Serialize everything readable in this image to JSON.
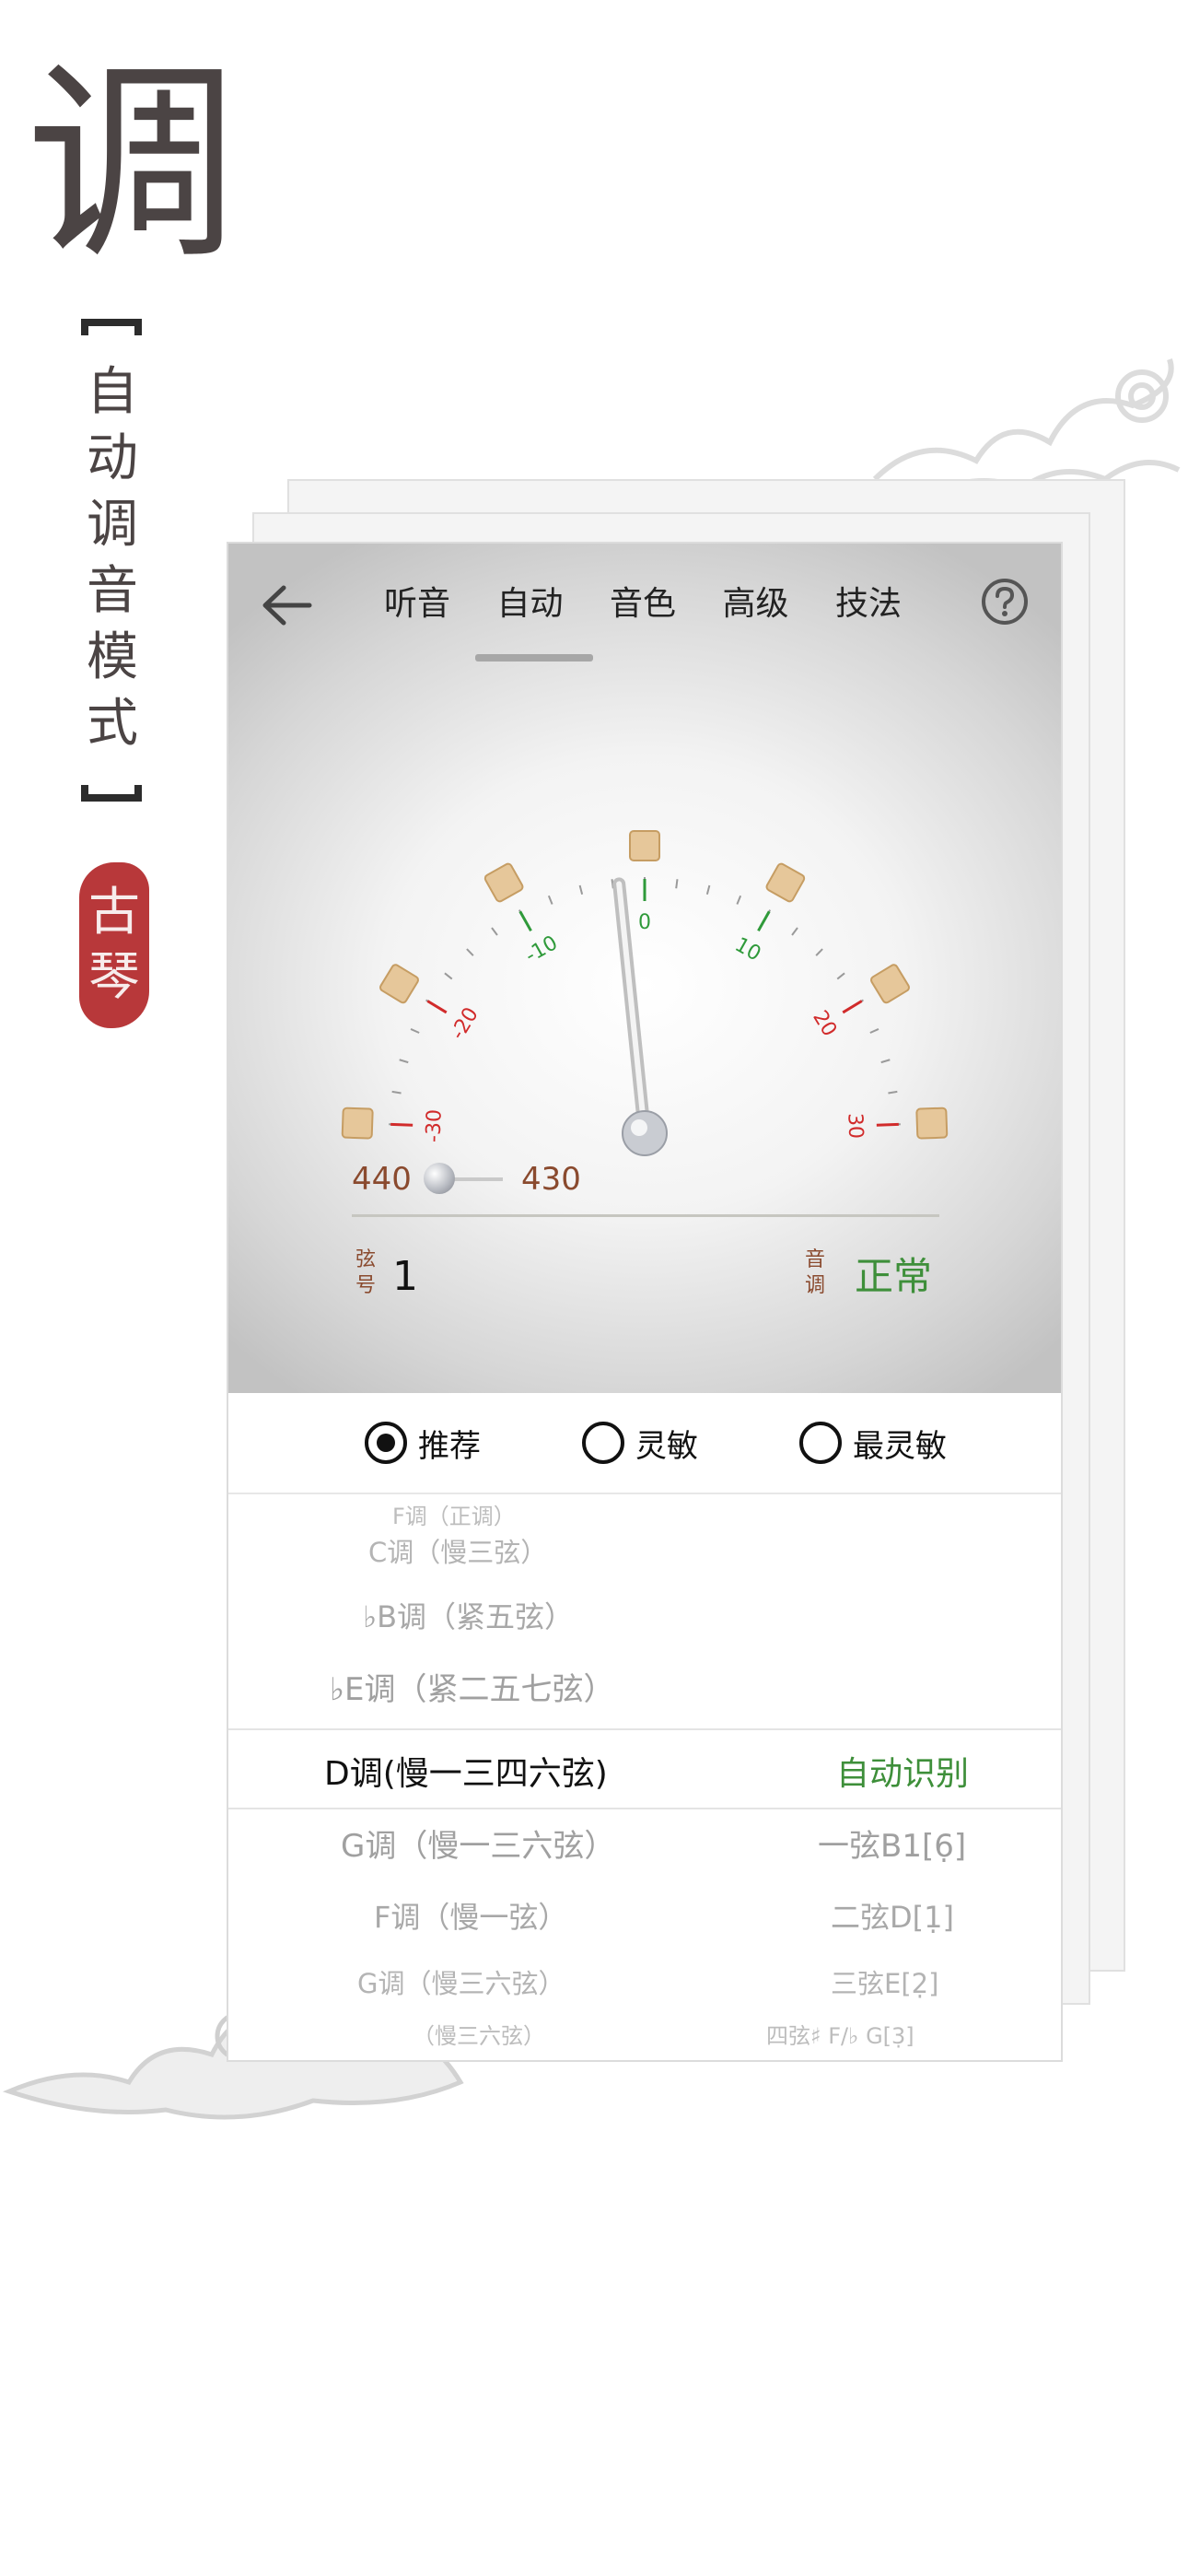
{
  "left_panel": {
    "big_char": "调",
    "mode_title": "自动调音模式",
    "seal_text": "古琴"
  },
  "header": {
    "tabs": [
      {
        "label": "听音"
      },
      {
        "label": "自动"
      },
      {
        "label": "音色"
      },
      {
        "label": "高级"
      },
      {
        "label": "技法"
      }
    ],
    "active_tab": 1
  },
  "gauge": {
    "ticks": [
      {
        "label": "-30",
        "color": "#d12b2b"
      },
      {
        "label": "-20",
        "color": "#d12b2b"
      },
      {
        "label": "-10",
        "color": "#2f9a3a"
      },
      {
        "label": "0",
        "color": "#2f9a3a"
      },
      {
        "label": "10",
        "color": "#2f9a3a"
      },
      {
        "label": "20",
        "color": "#d12b2b"
      },
      {
        "label": "30",
        "color": "#d12b2b"
      }
    ],
    "needle_value": -2
  },
  "reference": {
    "left_value": "440",
    "right_value": "430"
  },
  "status": {
    "string_label": "弦号",
    "string_value": "1",
    "tone_label": "音调",
    "tone_value": "正常"
  },
  "sensitivity": {
    "options": [
      "推荐",
      "灵敏",
      "最灵敏"
    ],
    "selected": "推荐"
  },
  "keys": {
    "above": [
      "F调（正调）",
      "C调（慢三弦）",
      "♭B调（紧五弦）",
      "♭E调（紧二五七弦）"
    ],
    "current": "D调(慢一三四六弦)",
    "current_right": "自动识别",
    "below": [
      "G调（慢一三六弦）",
      "F调（慢一弦）",
      "G调（慢三六弦）",
      "（慢三六弦）"
    ],
    "strings": [
      "一弦B1[6̣]",
      "二弦D[1̣]",
      "三弦E[2̣]",
      "四弦♯ F/♭ G[3̣]"
    ]
  },
  "colors": {
    "accent_green": "#3e8f3a",
    "accent_brown": "#8a4a2e",
    "seal_red": "#b8383a"
  }
}
